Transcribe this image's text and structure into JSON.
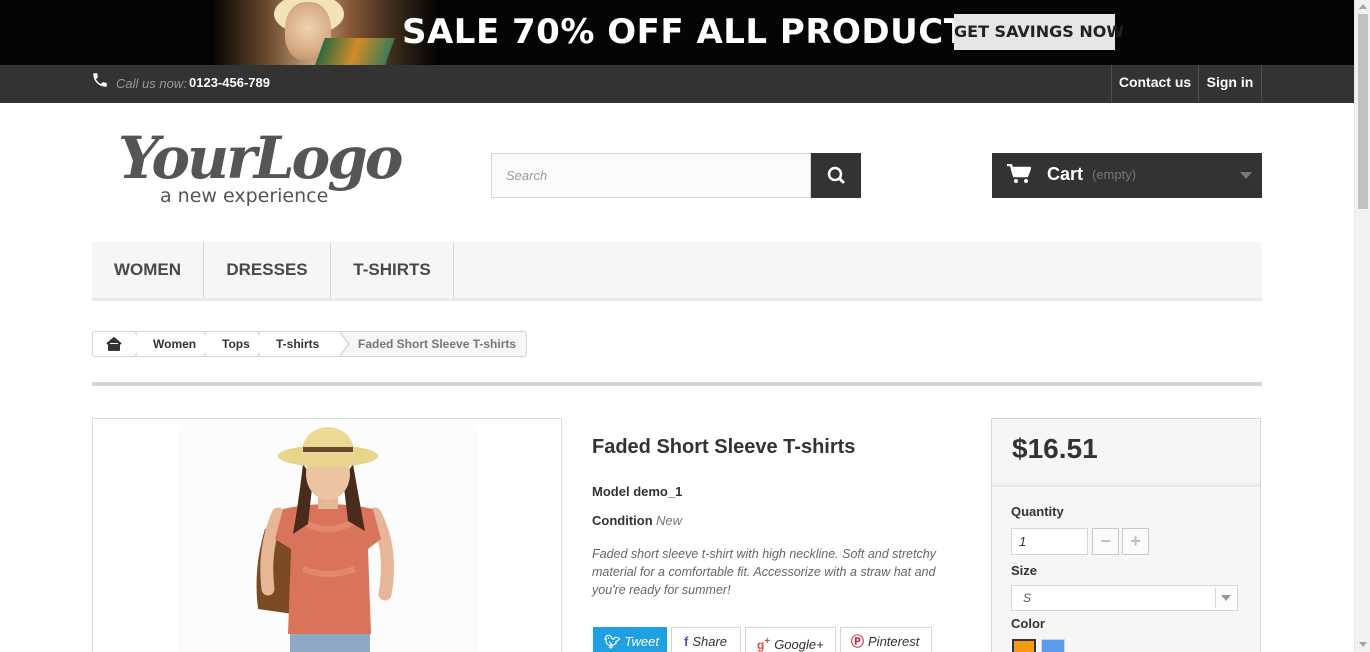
{
  "banner": {
    "headline": "SALE 70% OFF ALL PRODUCTS",
    "cta_label": "GET SAVINGS NOW"
  },
  "topbar": {
    "call_label": "Call us now:",
    "phone": "0123-456-789",
    "contact_label": "Contact us",
    "signin_label": "Sign in"
  },
  "logo": {
    "name": "YourLogo",
    "tagline": "a new experience"
  },
  "search": {
    "placeholder": "Search"
  },
  "cart": {
    "label": "Cart",
    "status": "(empty)"
  },
  "menu": {
    "items": [
      "WOMEN",
      "DRESSES",
      "T-SHIRTS"
    ]
  },
  "breadcrumb": {
    "items": [
      "Women",
      "Tops",
      "T-shirts"
    ],
    "current": "Faded Short Sleeve T-shirts"
  },
  "product": {
    "title": "Faded Short Sleeve T-shirts",
    "model_label": "Model",
    "model": "demo_1",
    "condition_label": "Condition",
    "condition": "New",
    "description": "Faded short sleeve t-shirt with high neckline. Soft and stretchy material for a comfortable fit. Accessorize with a straw hat and you're ready for summer!",
    "price": "$16.51"
  },
  "social": {
    "tweet": "Tweet",
    "share": "Share",
    "gplus": "Google+",
    "pinterest": "Pinterest"
  },
  "buybox": {
    "quantity_label": "Quantity",
    "quantity_value": "1",
    "size_label": "Size",
    "size_value": "S",
    "color_label": "Color",
    "colors": [
      "#f39c11",
      "#5d9cec"
    ]
  }
}
